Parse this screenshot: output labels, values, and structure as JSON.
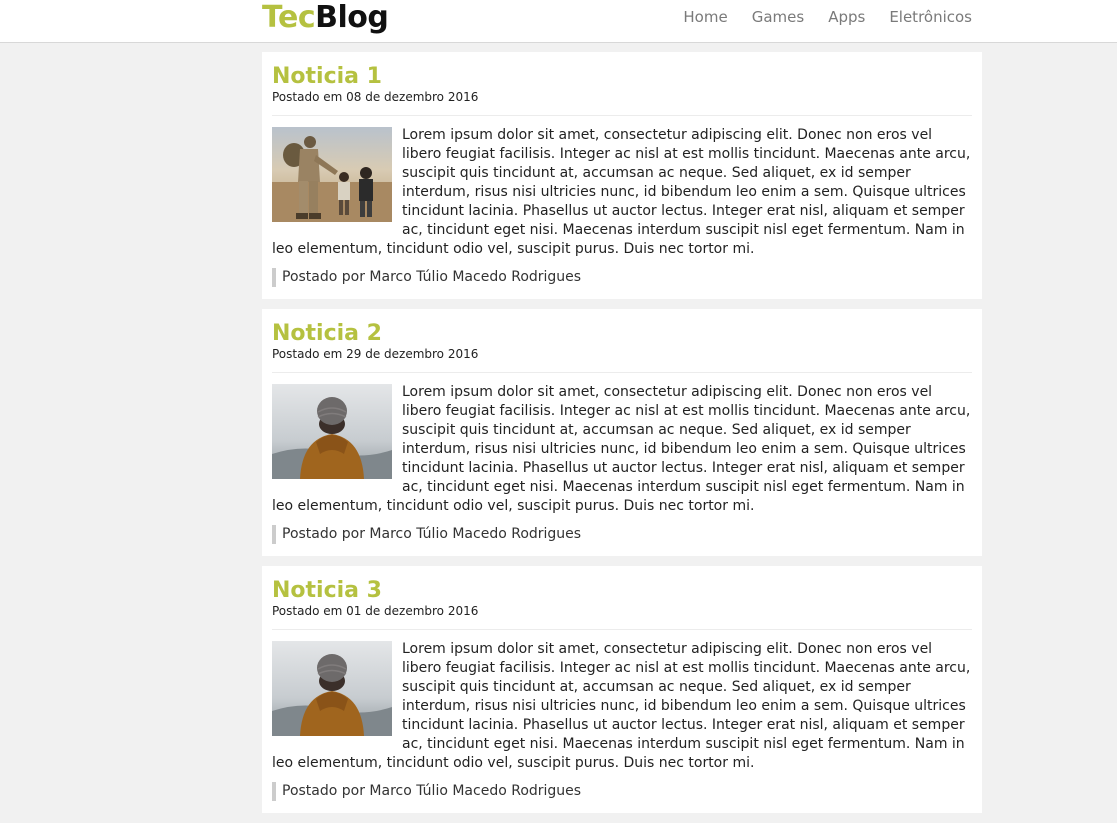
{
  "header": {
    "logo_part1": "Tec",
    "logo_part2": "Blog",
    "nav": [
      "Home",
      "Games",
      "Apps",
      "Eletrônicos"
    ]
  },
  "posts": [
    {
      "title": "Noticia 1",
      "date": "Postado em 08 de dezembro 2016",
      "image": "soldier-with-children-photo",
      "body": "Lorem ipsum dolor sit amet, consectetur adipiscing elit. Donec non eros vel libero feugiat facilisis. Integer ac nisl at est mollis tincidunt. Maecenas ante arcu, suscipit quis tincidunt at, accumsan ac neque. Sed aliquet, ex id semper interdum, risus nisi ultricies nunc, id bibendum leo enim a sem. Quisque ultrices tincidunt lacinia. Phasellus ut auctor lectus. Integer erat nisl, aliquam et semper ac, tincidunt eget nisi. Maecenas interdum suscipit nisl eget fermentum. Nam in leo elementum, tincidunt odio vel, suscipit purus. Duis nec tortor mi.",
      "author": "Postado por Marco Túlio Macedo Rodrigues"
    },
    {
      "title": "Noticia 2",
      "date": "Postado em 29 de dezembro 2016",
      "image": "person-in-beanie-photo",
      "body": "Lorem ipsum dolor sit amet, consectetur adipiscing elit. Donec non eros vel libero feugiat facilisis. Integer ac nisl at est mollis tincidunt. Maecenas ante arcu, suscipit quis tincidunt at, accumsan ac neque. Sed aliquet, ex id semper interdum, risus nisi ultricies nunc, id bibendum leo enim a sem. Quisque ultrices tincidunt lacinia. Phasellus ut auctor lectus. Integer erat nisl, aliquam et semper ac, tincidunt eget nisi. Maecenas interdum suscipit nisl eget fermentum. Nam in leo elementum, tincidunt odio vel, suscipit purus. Duis nec tortor mi.",
      "author": "Postado por Marco Túlio Macedo Rodrigues"
    },
    {
      "title": "Noticia 3",
      "date": "Postado em 01 de dezembro 2016",
      "image": "person-in-beanie-photo",
      "body": "Lorem ipsum dolor sit amet, consectetur adipiscing elit. Donec non eros vel libero feugiat facilisis. Integer ac nisl at est mollis tincidunt. Maecenas ante arcu, suscipit quis tincidunt at, accumsan ac neque. Sed aliquet, ex id semper interdum, risus nisi ultricies nunc, id bibendum leo enim a sem. Quisque ultrices tincidunt lacinia. Phasellus ut auctor lectus. Integer erat nisl, aliquam et semper ac, tincidunt eget nisi. Maecenas interdum suscipit nisl eget fermentum. Nam in leo elementum, tincidunt odio vel, suscipit purus. Duis nec tortor mi.",
      "author": "Postado por Marco Túlio Macedo Rodrigues"
    }
  ],
  "colors": {
    "accent": "#b5c140",
    "background": "#f1f1f1"
  }
}
